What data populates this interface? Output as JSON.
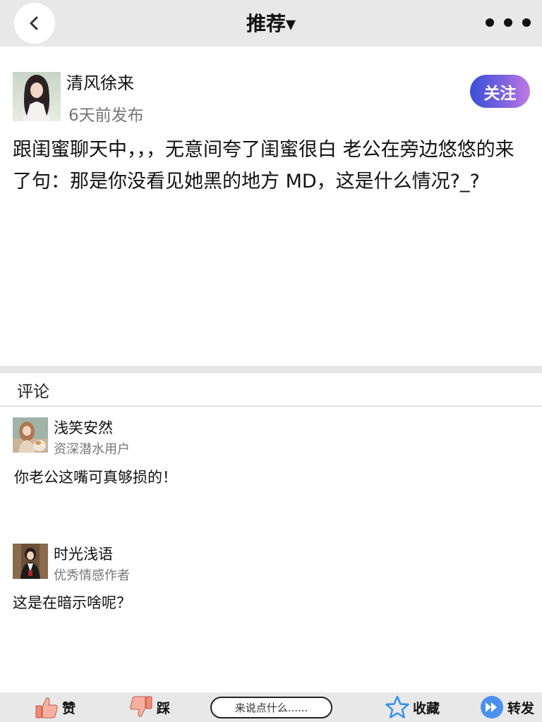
{
  "header": {
    "title": "推荐▾"
  },
  "post": {
    "author_name": "清风徐来",
    "post_time": "6天前发布",
    "follow_label": "关注",
    "content": "跟闺蜜聊天中，，，无意间夸了闺蜜很白 老公在旁边悠悠的来了句：那是你没看见她黑的地方 MD，这是什么情况?_?"
  },
  "comments_section": {
    "header": "评论",
    "comments": [
      {
        "name": "浅笑安然",
        "role": "资深潜水用户",
        "text": "你老公这嘴可真够损的！"
      },
      {
        "name": "时光浅语",
        "role": "优秀情感作者",
        "text": "这是在暗示啥呢？"
      }
    ]
  },
  "bottom_bar": {
    "like_label": "赞",
    "dislike_label": "踩",
    "comment_placeholder": "来说点什么......",
    "favorite_label": "收藏",
    "share_label": "转发"
  },
  "colors": {
    "follow_gradient_start": "#3a4fd6",
    "follow_gradient_end": "#c27ae2",
    "star_color": "#2f8ef0",
    "share_color": "#4a90f0",
    "thumb_color": "#f08a78"
  },
  "icons": {
    "back": "back-arrow-icon",
    "more": "more-dots-icon",
    "like": "thumbs-up-icon",
    "dislike": "thumbs-down-icon",
    "favorite": "star-icon",
    "share": "share-forward-icon"
  }
}
